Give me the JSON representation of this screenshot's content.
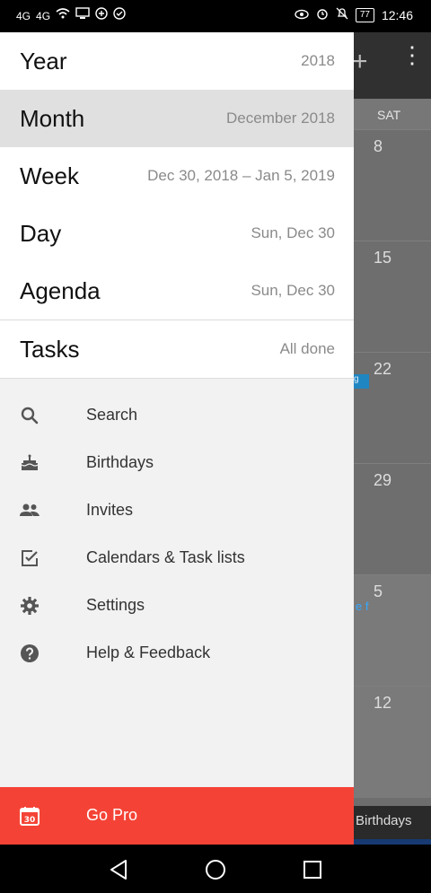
{
  "status_bar": {
    "left_icons": [
      "4G",
      "4G",
      "wifi-icon",
      "screen-icon",
      "app-icon",
      "check-icon"
    ],
    "right_icons": [
      "eye-icon",
      "alarm-icon",
      "mute-icon"
    ],
    "battery": "77",
    "time": "12:46"
  },
  "drawer": {
    "views": [
      {
        "label": "Year",
        "value": "2018",
        "selected": false
      },
      {
        "label": "Month",
        "value": "December 2018",
        "selected": true
      },
      {
        "label": "Week",
        "value": "Dec 30, 2018 – Jan 5, 2019",
        "selected": false
      },
      {
        "label": "Day",
        "value": "Sun, Dec 30",
        "selected": false
      },
      {
        "label": "Agenda",
        "value": "Sun, Dec 30",
        "selected": false
      }
    ],
    "tasks": {
      "label": "Tasks",
      "value": "All done"
    },
    "menu": [
      {
        "icon": "search-icon",
        "label": "Search"
      },
      {
        "icon": "birthday-cake-icon",
        "label": "Birthdays"
      },
      {
        "icon": "people-icon",
        "label": "Invites"
      },
      {
        "icon": "checklist-icon",
        "label": "Calendars & Task lists"
      },
      {
        "icon": "gear-icon",
        "label": "Settings"
      },
      {
        "icon": "help-icon",
        "label": "Help & Feedback"
      }
    ],
    "go_pro": {
      "icon": "calendar-30-icon",
      "icon_text": "30",
      "label": "Go Pro"
    }
  },
  "background_calendar": {
    "day_header": "SAT",
    "dates": [
      "8",
      "15",
      "22",
      "29",
      "5",
      "12"
    ],
    "event_fragment": "g",
    "link_fragment": "e f",
    "birthdays_fragment": "Birthdays"
  },
  "colors": {
    "accent": "#f44336",
    "selected_row": "#e0e0e0",
    "event": "#1f86c2"
  }
}
